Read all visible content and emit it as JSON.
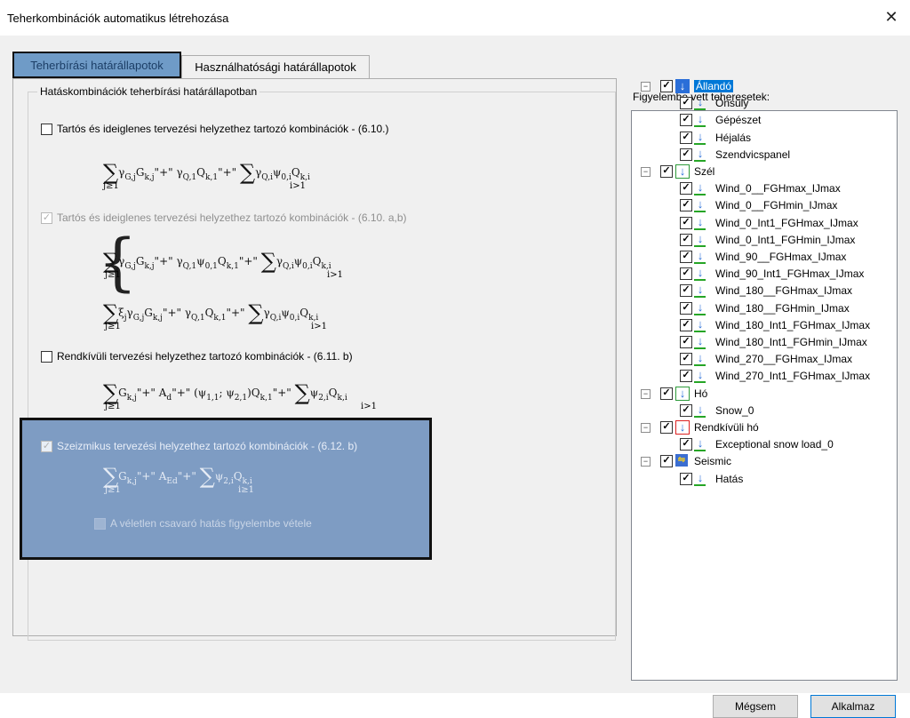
{
  "window": {
    "title": "Teherkombinációk automatikus létrehozása"
  },
  "tabs": [
    {
      "label": "Teherbírási határállapotok",
      "selected": true
    },
    {
      "label": "Használhatósági határállapotok",
      "selected": false
    }
  ],
  "group": {
    "title": "Hatáskombinációk teherbírási határállapotban"
  },
  "options": [
    {
      "label": "Tartós és ideiglenes tervezési helyzethez tartozó kombinációk - (6.10.)",
      "checked": false,
      "enabled": true
    },
    {
      "label": "Tartós és ideiglenes tervezési helyzethez tartozó kombinációk - (6.10. a,b)",
      "checked": true,
      "enabled": false
    },
    {
      "label": "Rendkívüli tervezési helyzethez tartozó kombinációk - (6.11. b)",
      "checked": false,
      "enabled": true
    },
    {
      "label": "Szeizmikus tervezési helyzethez tartozó kombinációk - (6.12. b)",
      "checked": true,
      "enabled": false
    },
    {
      "label": "A véletlen csavaró hatás figyelembe vétele",
      "checked": false,
      "enabled": false
    }
  ],
  "tree": {
    "label": "Figyelembe vett teheresetek:",
    "groups": [
      {
        "name": "Állandó",
        "selected": true,
        "items": [
          "Önsúly",
          "Gépészet",
          "Héjalás",
          "Szendvicspanel"
        ]
      },
      {
        "name": "Szél",
        "items": [
          "Wind_0__FGHmax_IJmax",
          "Wind_0__FGHmin_IJmax",
          "Wind_0_Int1_FGHmax_IJmax",
          "Wind_0_Int1_FGHmin_IJmax",
          "Wind_90__FGHmax_IJmax",
          "Wind_90_Int1_FGHmax_IJmax",
          "Wind_180__FGHmax_IJmax",
          "Wind_180__FGHmin_IJmax",
          "Wind_180_Int1_FGHmax_IJmax",
          "Wind_180_Int1_FGHmin_IJmax",
          "Wind_270__FGHmax_IJmax",
          "Wind_270_Int1_FGHmax_IJmax"
        ]
      },
      {
        "name": "Hó",
        "items": [
          "Snow_0"
        ]
      },
      {
        "name": "Rendkívüli hó",
        "items": [
          "Exceptional snow load_0"
        ]
      },
      {
        "name": "Seismic",
        "items": [
          "Hatás"
        ]
      }
    ]
  },
  "buttons": {
    "cancel": "Mégsem",
    "apply": "Alkalmaz"
  },
  "colors": {
    "highlight": "#7e9cc3",
    "selection": "#0078d7"
  }
}
